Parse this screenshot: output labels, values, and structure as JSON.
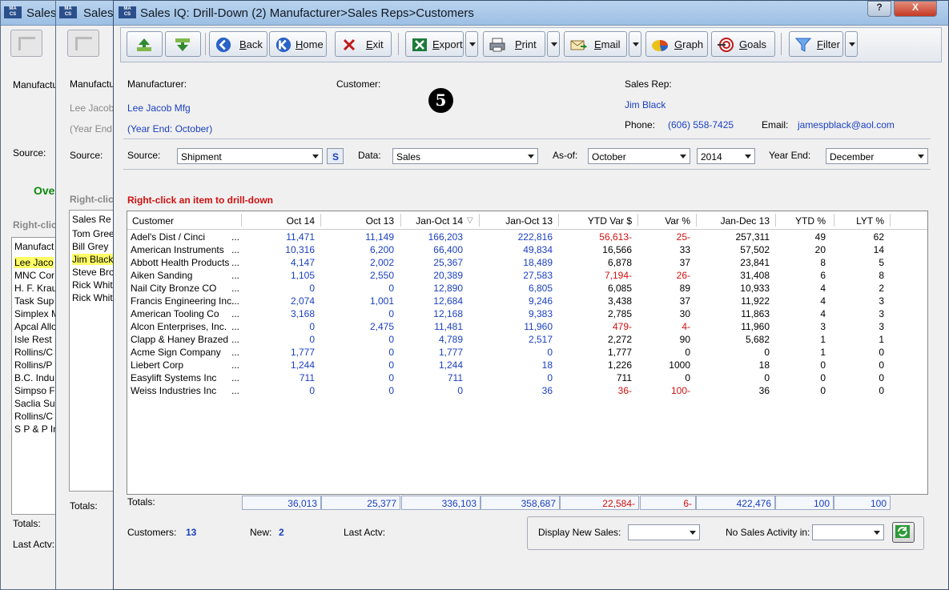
{
  "bg_windows": {
    "w1_title": "Sales",
    "w1_labels": [
      "Manufactu",
      "Source:",
      "Ove",
      "Right-clic",
      "Totals:",
      "Last Actv:"
    ],
    "w1_list_header": "Manufact",
    "w1_list": [
      "Lee Jaco",
      "MNC Cor",
      "H. F. Krau",
      "Task Sup",
      "Simplex M",
      "Apcal Allo",
      "Isle Rest",
      "Rollins/C",
      "Rollins/P",
      "B.C. Indu",
      "Simpso F",
      "Saclia Su",
      "Rollins/C",
      "S P & P In"
    ],
    "w2_title": "Sales",
    "w2_labels": [
      "Manufactu",
      "Lee Jacob",
      "(Year End",
      "Source:",
      "Right-clic",
      "Totals:"
    ],
    "w2_list_header": "Sales Re",
    "w2_list": [
      "Tom Gree",
      "Bill Grey",
      "Jim Black",
      "Steve Bro",
      "Rick Whit",
      "Rick Whit"
    ]
  },
  "window": {
    "title": "Sales IQ: Drill-Down (2) Manufacturer>Sales Reps>Customers",
    "app_icon": "MACS",
    "help": "?",
    "close": "X"
  },
  "toolbar": {
    "back": "Back",
    "home": "Home",
    "exit": "Exit",
    "export": "Export",
    "print": "Print",
    "email": "Email",
    "graph": "Graph",
    "goals": "Goals",
    "filter": "Filter"
  },
  "header": {
    "manufacturer_label": "Manufacturer:",
    "manufacturer": "Lee Jacob Mfg",
    "year_end_note": "(Year End: October)",
    "customer_label": "Customer:",
    "step_badge": "5",
    "sales_rep_label": "Sales Rep:",
    "sales_rep": "Jim Black",
    "phone_label": "Phone:",
    "phone": "(606) 558-7425",
    "email_label": "Email:",
    "email": "jamespblack@aol.com"
  },
  "filters": {
    "source_label": "Source:",
    "source": "Shipment",
    "s_button": "S",
    "data_label": "Data:",
    "data": "Sales",
    "asof_label": "As-of:",
    "asof_month": "October",
    "asof_year": "2014",
    "yearend_label": "Year End:",
    "yearend": "December"
  },
  "hint": "Right-click an item to drill-down",
  "grid": {
    "columns": [
      "Customer",
      "Oct 14",
      "Oct 13",
      "Jan-Oct 14",
      "Jan-Oct 13",
      "YTD Var $",
      "Var %",
      "Jan-Dec 13",
      "YTD %",
      "LYT %"
    ],
    "rows": [
      {
        "customer": "Adel's Dist / Cinci",
        "c1": "11,471",
        "c2": "11,149",
        "c3": "166,203",
        "c4": "222,816",
        "c5": "56,613-",
        "c6": "25-",
        "c7": "257,311",
        "c8": "49",
        "c9": "62",
        "neg5": true,
        "neg6": true
      },
      {
        "customer": "American Instruments",
        "c1": "10,316",
        "c2": "6,200",
        "c3": "66,400",
        "c4": "49,834",
        "c5": "16,566",
        "c6": "33",
        "c7": "57,502",
        "c8": "20",
        "c9": "14"
      },
      {
        "customer": "Abbott Health Products",
        "c1": "4,147",
        "c2": "2,002",
        "c3": "25,367",
        "c4": "18,489",
        "c5": "6,878",
        "c6": "37",
        "c7": "23,841",
        "c8": "8",
        "c9": "5"
      },
      {
        "customer": "Aiken Sanding",
        "c1": "1,105",
        "c2": "2,550",
        "c3": "20,389",
        "c4": "27,583",
        "c5": "7,194-",
        "c6": "26-",
        "c7": "31,408",
        "c8": "6",
        "c9": "8",
        "neg5": true,
        "neg6": true
      },
      {
        "customer": "Nail City Bronze CO",
        "c1": "0",
        "c2": "0",
        "c3": "12,890",
        "c4": "6,805",
        "c5": "6,085",
        "c6": "89",
        "c7": "10,933",
        "c8": "4",
        "c9": "2"
      },
      {
        "customer": "Francis Engineering Inc.",
        "c1": "2,074",
        "c2": "1,001",
        "c3": "12,684",
        "c4": "9,246",
        "c5": "3,438",
        "c6": "37",
        "c7": "11,922",
        "c8": "4",
        "c9": "3"
      },
      {
        "customer": "American Tooling Co",
        "c1": "3,168",
        "c2": "0",
        "c3": "12,168",
        "c4": "9,383",
        "c5": "2,785",
        "c6": "30",
        "c7": "11,863",
        "c8": "4",
        "c9": "3"
      },
      {
        "customer": "Alcon Enterprises, Inc.",
        "c1": "0",
        "c2": "2,475",
        "c3": "11,481",
        "c4": "11,960",
        "c5": "479-",
        "c6": "4-",
        "c7": "11,960",
        "c8": "3",
        "c9": "3",
        "neg5": true,
        "neg6": true
      },
      {
        "customer": "Clapp & Haney Brazed",
        "c1": "0",
        "c2": "0",
        "c3": "4,789",
        "c4": "2,517",
        "c5": "2,272",
        "c6": "90",
        "c7": "5,682",
        "c8": "1",
        "c9": "1"
      },
      {
        "customer": "Acme Sign Company",
        "c1": "1,777",
        "c2": "0",
        "c3": "1,777",
        "c4": "0",
        "c5": "1,777",
        "c6": "0",
        "c7": "0",
        "c8": "1",
        "c9": "0"
      },
      {
        "customer": "Liebert Corp",
        "c1": "1,244",
        "c2": "0",
        "c3": "1,244",
        "c4": "18",
        "c5": "1,226",
        "c6": "1000",
        "c7": "18",
        "c8": "0",
        "c9": "0"
      },
      {
        "customer": "Easylift Systems Inc",
        "c1": "711",
        "c2": "0",
        "c3": "711",
        "c4": "0",
        "c5": "711",
        "c6": "0",
        "c7": "0",
        "c8": "0",
        "c9": "0"
      },
      {
        "customer": "Weiss Industries Inc",
        "c1": "0",
        "c2": "0",
        "c3": "0",
        "c4": "36",
        "c5": "36-",
        "c6": "100-",
        "c7": "36",
        "c8": "0",
        "c9": "0",
        "neg5": true,
        "neg6": true
      }
    ]
  },
  "totals": {
    "label": "Totals:",
    "values": [
      "36,013",
      "25,377",
      "336,103",
      "358,687",
      "22,584-",
      "6-",
      "422,476",
      "100",
      "100"
    ]
  },
  "footer": {
    "customers_label": "Customers:",
    "customers": "13",
    "new_label": "New:",
    "new": "2",
    "lastactv_label": "Last Actv:",
    "display_new_label": "Display New Sales:",
    "no_activity_label": "No Sales Activity in:"
  },
  "colors": {
    "accent_blue": "#1a3fbf",
    "negative_red": "#d01010",
    "highlight": "#ffff66"
  }
}
